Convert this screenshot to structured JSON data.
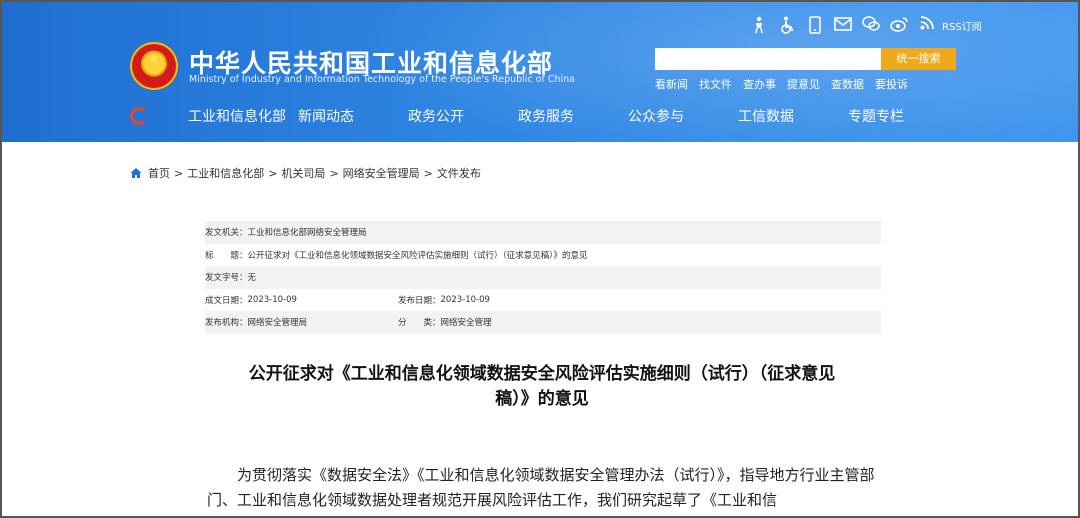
{
  "header": {
    "title": "中华人民共和国工业和信息化部",
    "subtitle": "Ministry of Industry and Information Technology of the People's Republic of China",
    "top_icons": [
      "accessibility-elder-icon",
      "wheelchair-icon",
      "mobile-icon",
      "mail-icon",
      "wechat-icon",
      "weibo-icon",
      "rss-icon"
    ],
    "rss_label": "RSS订阅",
    "search": {
      "placeholder": "",
      "button": "统一搜索"
    },
    "quick_links": [
      "看新闻",
      "找文件",
      "查办事",
      "提意见",
      "查数据",
      "要投诉"
    ],
    "nav": [
      "工业和信息化部",
      "新闻动态",
      "政务公开",
      "政务服务",
      "公众参与",
      "工信数据",
      "专题专栏"
    ]
  },
  "breadcrumb": [
    "首页",
    "工业和信息化部",
    "机关司局",
    "网络安全管理局",
    "文件发布"
  ],
  "info": {
    "issuer_label": "发文机关：",
    "issuer": "工业和信息化部网络安全管理局",
    "title_label": "标　　题：",
    "title": "公开征求对《工业和信息化领域数据安全风险评估实施细则（试行）（征求意见稿）》的意见",
    "docno_label": "发文字号：",
    "docno": "无",
    "created_label": "成文日期：",
    "created": "2023-10-09",
    "published_label": "发布日期：",
    "published": "2023-10-09",
    "org_label": "发布机构：",
    "org": "网络安全管理局",
    "category_label": "分　　类：",
    "category": "网络安全管理"
  },
  "article": {
    "title_line1": "公开征求对《工业和信息化领域数据安全风险评估实施细则（试行）（征求意见",
    "title_line2": "稿）》的意见",
    "body": "为贯彻落实《数据安全法》《工业和信息化领域数据安全管理办法（试行）》，指导地方行业主管部门、工业和信息化领域数据处理者规范开展风险评估工作，我们研究起草了《工业和信"
  },
  "colors": {
    "header_blue": "#2f86e3",
    "search_button": "#f0a91c",
    "accent_red": "#e8472a"
  }
}
